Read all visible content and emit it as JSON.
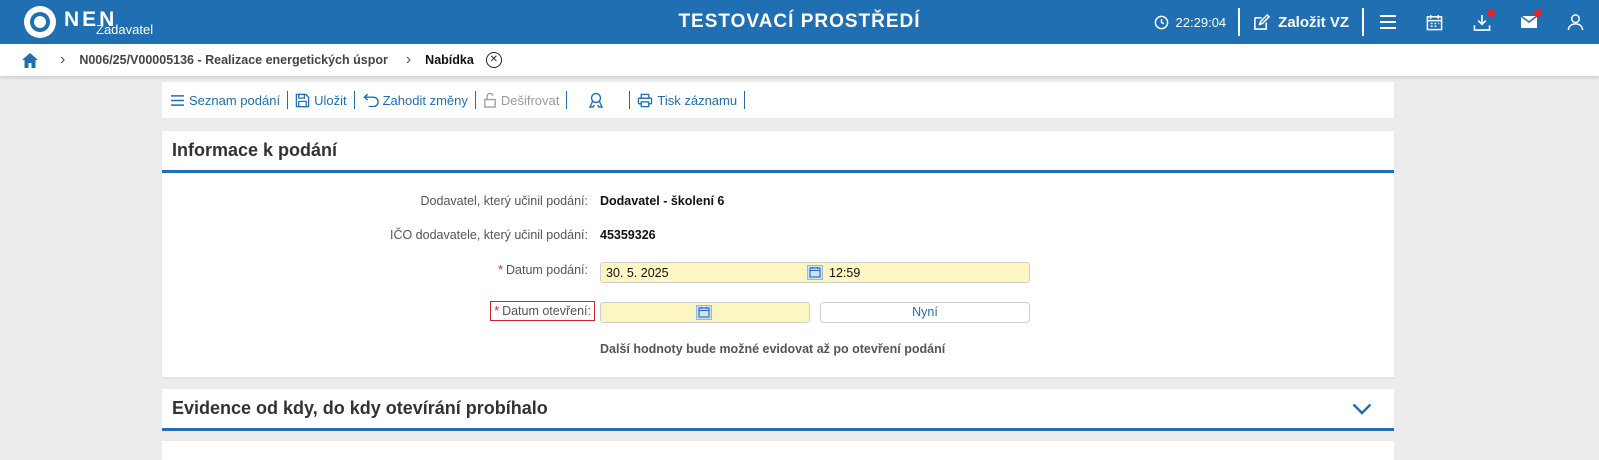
{
  "header": {
    "logo_text": "NEN",
    "logo_sub": "Zadavatel",
    "env_title": "TESTOVACÍ PROSTŘEDÍ",
    "clock": "22:29:04",
    "create_label": "Založit VZ",
    "icons": [
      "clock-icon",
      "edit-icon",
      "menu-icon",
      "calendar-icon",
      "download-icon",
      "mail-icon",
      "user-icon"
    ],
    "accent": "#1f6fb2",
    "notify_color": "#e0262b"
  },
  "breadcrumb": {
    "item1": "N006/25/V00005136 - Realizace energetických úspor",
    "current": "Nabídka"
  },
  "toolbar": {
    "list": "Seznam podání",
    "save": "Uložit",
    "discard": "Zahodit změny",
    "decrypt": "Dešifrovat",
    "print": "Tisk záznamu"
  },
  "info": {
    "title": "Informace k podání",
    "supplier_label": "Dodavatel, který učinil podání:",
    "supplier_value": "Dodavatel - školení 6",
    "ico_label": "IČO dodavatele, který učinil podání:",
    "ico_value": "45359326",
    "req_mark": "*",
    "date_submit_label": "Datum podání:",
    "date_submit_value": "30. 5. 2025",
    "time_submit_value": "12:59",
    "date_open_label": "Datum otevření:",
    "date_open_value": "",
    "now_button": "Nyní",
    "note": "Další hodnoty bude možné evidovat až po otevření podání"
  },
  "evidence": {
    "title": "Evidence od kdy, do kdy otevírání probíhalo"
  }
}
